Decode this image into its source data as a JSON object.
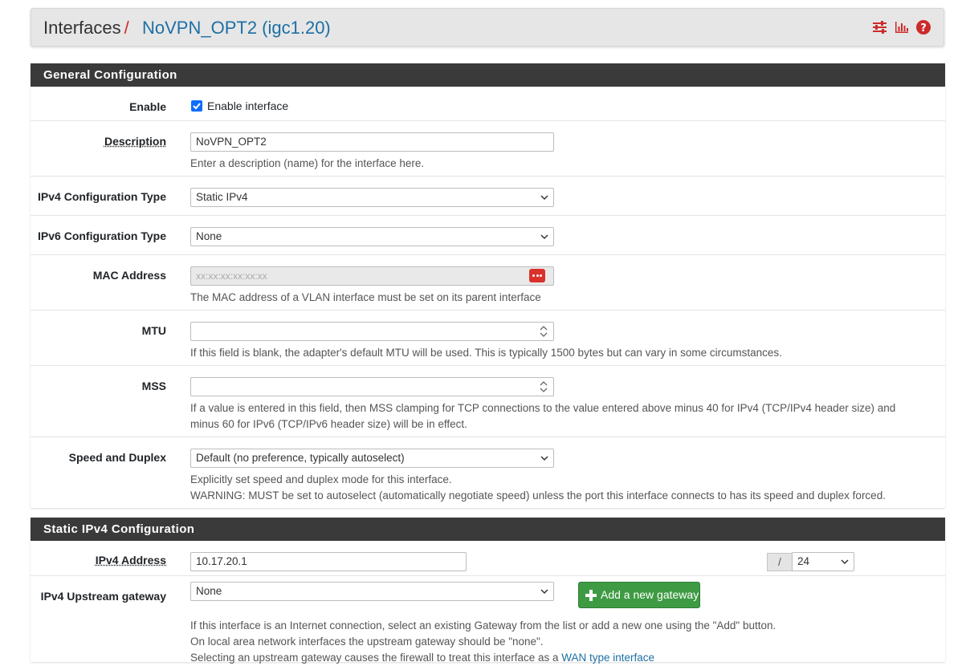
{
  "breadcrumb": {
    "root": "Interfaces",
    "separator": "/",
    "current": "NoVPN_OPT2 (igc1.20)",
    "icons": [
      "sliders-icon",
      "bar-chart-icon",
      "help-icon"
    ]
  },
  "colors": {
    "accent_red": "#cc2b2b",
    "link_blue": "#1d6fa5",
    "header_dark": "#3a3a3a",
    "button_green": "#3e9b43",
    "checkbox_blue": "#0d6efd"
  },
  "general": {
    "heading": "General Configuration",
    "enable": {
      "label": "Enable",
      "checkbox_label": "Enable interface",
      "checked": true
    },
    "description": {
      "label": "Description",
      "value": "NoVPN_OPT2",
      "help": "Enter a description (name) for the interface here."
    },
    "ipv4_type": {
      "label": "IPv4 Configuration Type",
      "value": "Static IPv4"
    },
    "ipv6_type": {
      "label": "IPv6 Configuration Type",
      "value": "None"
    },
    "mac": {
      "label": "MAC Address",
      "placeholder": "xx:xx:xx:xx:xx:xx",
      "help": "The MAC address of a VLAN interface must be set on its parent interface"
    },
    "mtu": {
      "label": "MTU",
      "value": "",
      "help": "If this field is blank, the adapter's default MTU will be used. This is typically 1500 bytes but can vary in some circumstances."
    },
    "mss": {
      "label": "MSS",
      "value": "",
      "help_line1": "If a value is entered in this field, then MSS clamping for TCP connections to the value entered above minus 40 for IPv4 (TCP/IPv4 header size) and",
      "help_line2": "minus 60 for IPv6 (TCP/IPv6 header size) will be in effect."
    },
    "speed": {
      "label": "Speed and Duplex",
      "value": "Default (no preference, typically autoselect)",
      "help_line1": "Explicitly set speed and duplex mode for this interface.",
      "help_line2": "WARNING: MUST be set to autoselect (automatically negotiate speed) unless the port this interface connects to has its speed and duplex forced."
    }
  },
  "static_ipv4": {
    "heading": "Static IPv4 Configuration",
    "address": {
      "label": "IPv4 Address",
      "value": "10.17.20.1",
      "slash": "/",
      "cidr": "24"
    },
    "gateway": {
      "label": "IPv4 Upstream gateway",
      "value": "None",
      "add_button": "Add a new gateway",
      "help_line1": "If this interface is an Internet connection, select an existing Gateway from the list or add a new one using the \"Add\" button.",
      "help_line2": "On local area network interfaces the upstream gateway should be \"none\".",
      "help_line3_pre": "Selecting an upstream gateway causes the firewall to treat this interface as a ",
      "help_line3_link": "WAN type interface"
    }
  }
}
